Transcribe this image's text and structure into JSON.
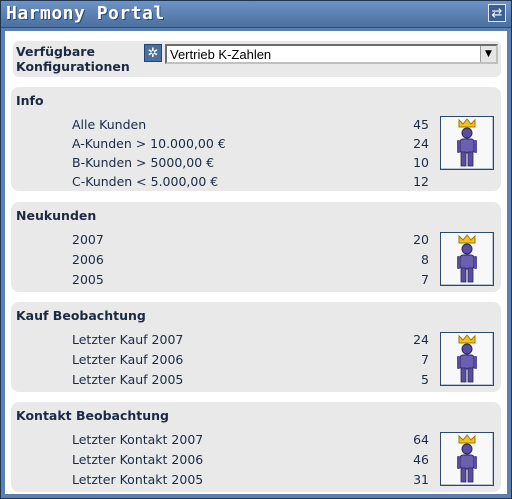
{
  "window": {
    "title": "Harmony Portal"
  },
  "icons": {
    "refresh": "refresh-icon",
    "settings": "gear-icon",
    "dropdown": "chevron-down-icon",
    "user": "crowned-user-icon"
  },
  "config": {
    "label_line1": "Verfügbare",
    "label_line2": "Konfigurationen",
    "selected": "Vertrieb K-Zahlen"
  },
  "panels": [
    {
      "title": "Info",
      "rows": [
        {
          "label": "Alle Kunden",
          "value": "45"
        },
        {
          "label": "A-Kunden > 10.000,00 €",
          "value": "24"
        },
        {
          "label": "B-Kunden > 5000,00 €",
          "value": "10"
        },
        {
          "label": "C-Kunden < 5.000,00 €",
          "value": "12"
        }
      ]
    },
    {
      "title": "Neukunden",
      "rows": [
        {
          "label": "2007",
          "value": "20"
        },
        {
          "label": "2006",
          "value": "8"
        },
        {
          "label": "2005",
          "value": "7"
        }
      ]
    },
    {
      "title": "Kauf Beobachtung",
      "rows": [
        {
          "label": "Letzter Kauf 2007",
          "value": "24"
        },
        {
          "label": "Letzter Kauf 2006",
          "value": "7"
        },
        {
          "label": "Letzter Kauf 2005",
          "value": "5"
        }
      ]
    },
    {
      "title": "Kontakt Beobachtung",
      "rows": [
        {
          "label": "Letzter Kontakt 2007",
          "value": "64"
        },
        {
          "label": "Letzter Kontakt 2006",
          "value": "46"
        },
        {
          "label": "Letzter Kontakt 2005",
          "value": "31"
        }
      ]
    }
  ]
}
